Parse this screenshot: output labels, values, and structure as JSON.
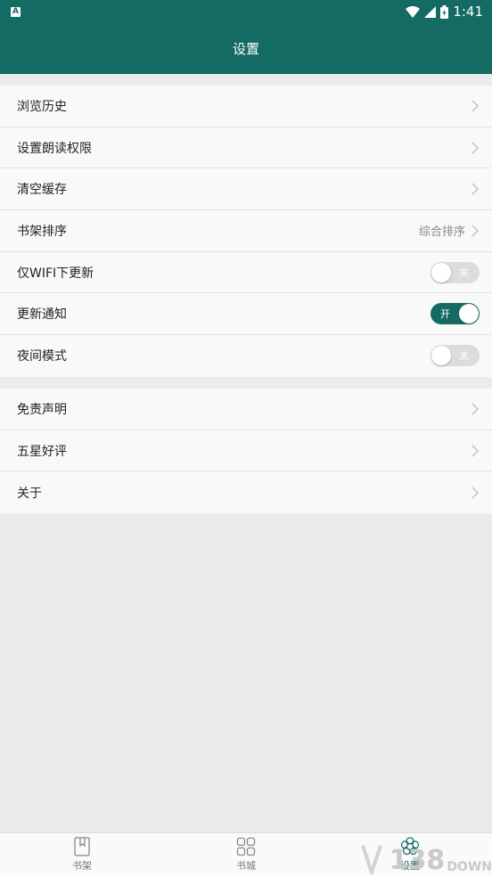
{
  "status": {
    "notification_icon": "A",
    "time": "1:41"
  },
  "header": {
    "title": "设置"
  },
  "group1": [
    {
      "label": "浏览历史"
    },
    {
      "label": "设置朗读权限"
    },
    {
      "label": "清空缓存"
    },
    {
      "label": "书架排序",
      "value": "综合排序"
    },
    {
      "label": "仅WIFI下更新",
      "toggle": "关",
      "state": "off"
    },
    {
      "label": "更新通知",
      "toggle": "开",
      "state": "on"
    },
    {
      "label": "夜间模式",
      "toggle": "关",
      "state": "off"
    }
  ],
  "group2": [
    {
      "label": "免责声明"
    },
    {
      "label": "五星好评"
    },
    {
      "label": "关于"
    }
  ],
  "tabs": [
    {
      "label": "书架",
      "icon": "bookshelf-icon"
    },
    {
      "label": "书城",
      "icon": "grid-icon"
    },
    {
      "label": "设置",
      "icon": "settings-flower-icon",
      "active": true
    }
  ],
  "watermark": {
    "number": "138",
    "text": "DOWN"
  },
  "colors": {
    "primary": "#136b63",
    "background": "#ebebeb",
    "row_bg": "#f9f9f9"
  }
}
